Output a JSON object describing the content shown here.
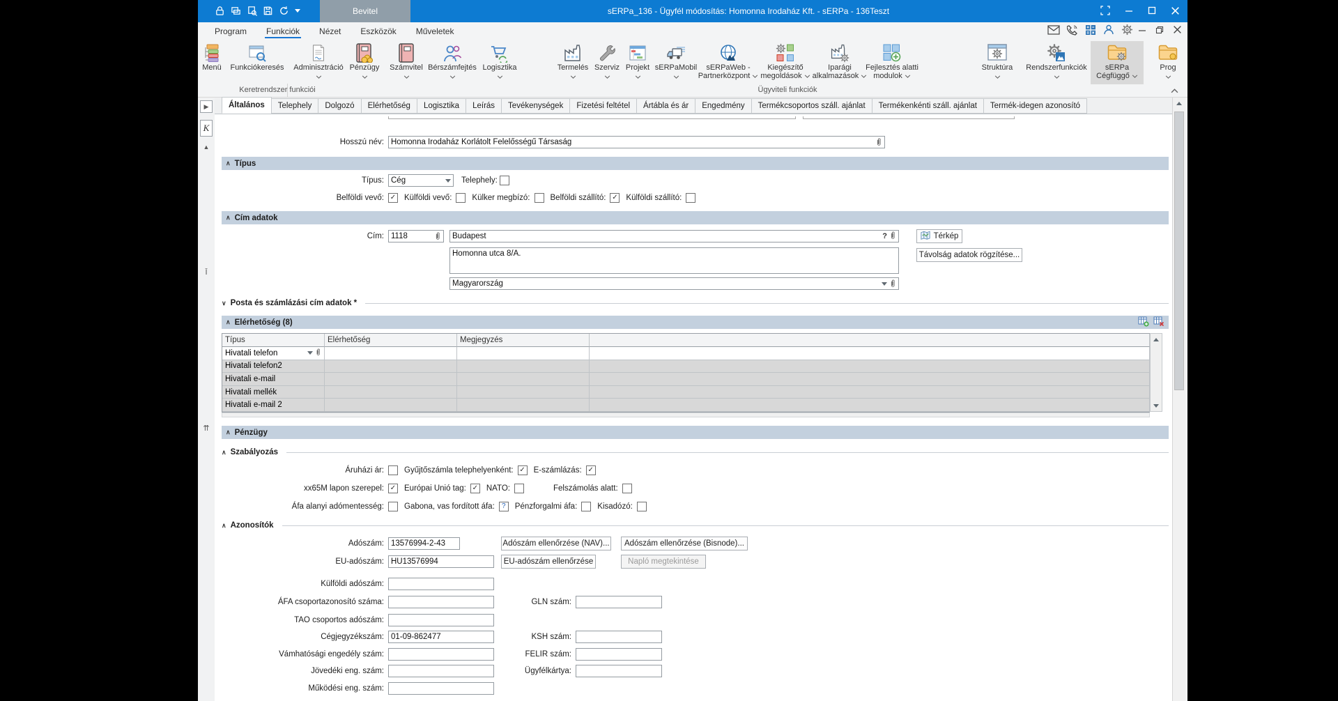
{
  "titlebar": {
    "title": "sERPa_136 - Ügyfél módosítás: Homonna Irodaház Kft. - sERPa - 136Teszt",
    "document_tab": "Bevitel"
  },
  "menubar": {
    "items": [
      "Program",
      "Funkciók",
      "Nézet",
      "Eszközök",
      "Műveletek"
    ]
  },
  "ribbon": {
    "groups": {
      "left": "Keretrendszer funkciói",
      "right": "Ügyviteli funkciók"
    },
    "buttons": [
      {
        "label": "Menü",
        "label2": ""
      },
      {
        "label": "Funkciókeresés",
        "label2": ""
      },
      {
        "label": "Adminisztráció",
        "label2": ""
      },
      {
        "label": "Pénzügy",
        "label2": ""
      },
      {
        "label": "Számvitel",
        "label2": ""
      },
      {
        "label": "Bérszámfejtés",
        "label2": ""
      },
      {
        "label": "Logisztika",
        "label2": ""
      },
      {
        "label": "Termelés",
        "label2": ""
      },
      {
        "label": "Szerviz",
        "label2": ""
      },
      {
        "label": "Projekt",
        "label2": ""
      },
      {
        "label": "sERPaMobil",
        "label2": ""
      },
      {
        "label": "sERPaWeb -",
        "label2": "Partnerközpont"
      },
      {
        "label": "Kiegészítő",
        "label2": "megoldások"
      },
      {
        "label": "Iparági",
        "label2": "alkalmazások"
      },
      {
        "label": "Fejlesztés alatti",
        "label2": "modulok"
      },
      {
        "label": "Struktúra",
        "label2": ""
      },
      {
        "label": "Rendszerfunkciók",
        "label2": ""
      },
      {
        "label": "sERPa",
        "label2": "Cégfüggő"
      },
      {
        "label": "Prog",
        "label2": ""
      }
    ]
  },
  "tabs": {
    "items": [
      "Általános",
      "Telephely",
      "Dolgozó",
      "Elérhetőség",
      "Logisztika",
      "Leírás",
      "Tevékenységek",
      "Fizetési feltétel",
      "Ártábla és ár",
      "Engedmény",
      "Termékcsoportos száll. ajánlat",
      "Termékenkénti száll. ajánlat",
      "Termék-idegen azonosító"
    ]
  },
  "form": {
    "long_name": {
      "label": "Hosszú név:",
      "value": "Homonna Irodaház Korlátolt Felelősségű Társaság"
    },
    "tipus": {
      "title": "Típus",
      "combo_label": "Típus:",
      "combo_value": "Cég",
      "telephely_label": "Telephely:",
      "telephely_state": "",
      "checks": [
        {
          "label": "Belföldi vevő:",
          "state": "✓"
        },
        {
          "label": "Külföldi vevő:",
          "state": ""
        },
        {
          "label": "Külker megbízó:",
          "state": ""
        },
        {
          "label": "Belföldi szállító:",
          "state": "✓"
        },
        {
          "label": "Külföldi szállító:",
          "state": ""
        }
      ]
    },
    "cim": {
      "title": "Cím adatok",
      "label": "Cím:",
      "zip": "1118",
      "city": "Budapest",
      "hint": "?",
      "street": "Homonna utca 8/A.",
      "country": "Magyarország",
      "map_button": "Térkép",
      "distance_button": "Távolság adatok rögzítése..."
    },
    "posta": {
      "title": "Posta és számlázási cím adatok *"
    },
    "contacts": {
      "title": "Elérhetőség (8)",
      "columns": [
        "Típus",
        "Elérhetőség",
        "Megjegyzés"
      ],
      "rows": [
        {
          "tipus": "Hivatali telefon",
          "elerhetoseg": "",
          "megjegyzes": ""
        },
        {
          "tipus": "Hivatali telefon2",
          "elerhetoseg": "",
          "megjegyzes": ""
        },
        {
          "tipus": "Hivatali e-mail",
          "elerhetoseg": "",
          "megjegyzes": ""
        },
        {
          "tipus": "Hivatali mellék",
          "elerhetoseg": "",
          "megjegyzes": ""
        },
        {
          "tipus": "Hivatali e-mail 2",
          "elerhetoseg": "",
          "megjegyzes": ""
        }
      ]
    },
    "penzugy": {
      "title": "Pénzügy"
    },
    "szabalyozas": {
      "title": "Szabályozás",
      "row1": [
        {
          "label": "Áruházi ár:",
          "state": ""
        },
        {
          "label": "Gyűjtőszámla telephelyenként:",
          "state": "✓"
        },
        {
          "label": "E-számlázás:",
          "state": "✓"
        }
      ],
      "row2": [
        {
          "label": "xx65M lapon szerepel:",
          "state": "✓"
        },
        {
          "label": "Európai Unió tag:",
          "state": "✓"
        },
        {
          "label": "NATO:",
          "state": ""
        },
        {
          "label": "Felszámolás alatt:",
          "state": ""
        }
      ],
      "row3": [
        {
          "label": "Áfa alanyi adómentesség:",
          "state": ""
        },
        {
          "label": "Gabona, vas fordított áfa:",
          "state": "?"
        },
        {
          "label": "Pénzforgalmi áfa:",
          "state": ""
        },
        {
          "label": "Kisadózó:",
          "state": ""
        }
      ]
    },
    "azonositok": {
      "title": "Azonosítók",
      "adoszam": {
        "label": "Adószám:",
        "value": "13576994-2-43"
      },
      "eu_adoszam": {
        "label": "EU-adószám:",
        "value": "HU13576994"
      },
      "kulfoldi": {
        "label": "Külföldi adószám:",
        "value": ""
      },
      "afa_csoport": {
        "label": "ÁFA csoportazonosító száma:",
        "value": ""
      },
      "gln": {
        "label": "GLN szám:",
        "value": ""
      },
      "tao": {
        "label": "TAO csoportos adószám:",
        "value": ""
      },
      "cegjegyzek": {
        "label": "Cégjegyzékszám:",
        "value": "01-09-862477"
      },
      "ksh": {
        "label": "KSH szám:",
        "value": ""
      },
      "vamhatosagi": {
        "label": "Vámhatósági engedély szám:",
        "value": ""
      },
      "felir": {
        "label": "FELIR szám:",
        "value": ""
      },
      "jovedeki": {
        "label": "Jövedéki eng. szám:",
        "value": ""
      },
      "ugyfelkartya": {
        "label": "Ügyfélkártya:",
        "value": ""
      },
      "mukodesi": {
        "label": "Működési eng. szám:",
        "value": ""
      },
      "buttons": {
        "nav": "Adószám ellenőrzése (NAV)...",
        "bisnode": "Adószám ellenőrzése (Bisnode)...",
        "eu_check": "EU-adószám ellenőrzése",
        "naplo": "Napló megtekintése"
      }
    }
  }
}
